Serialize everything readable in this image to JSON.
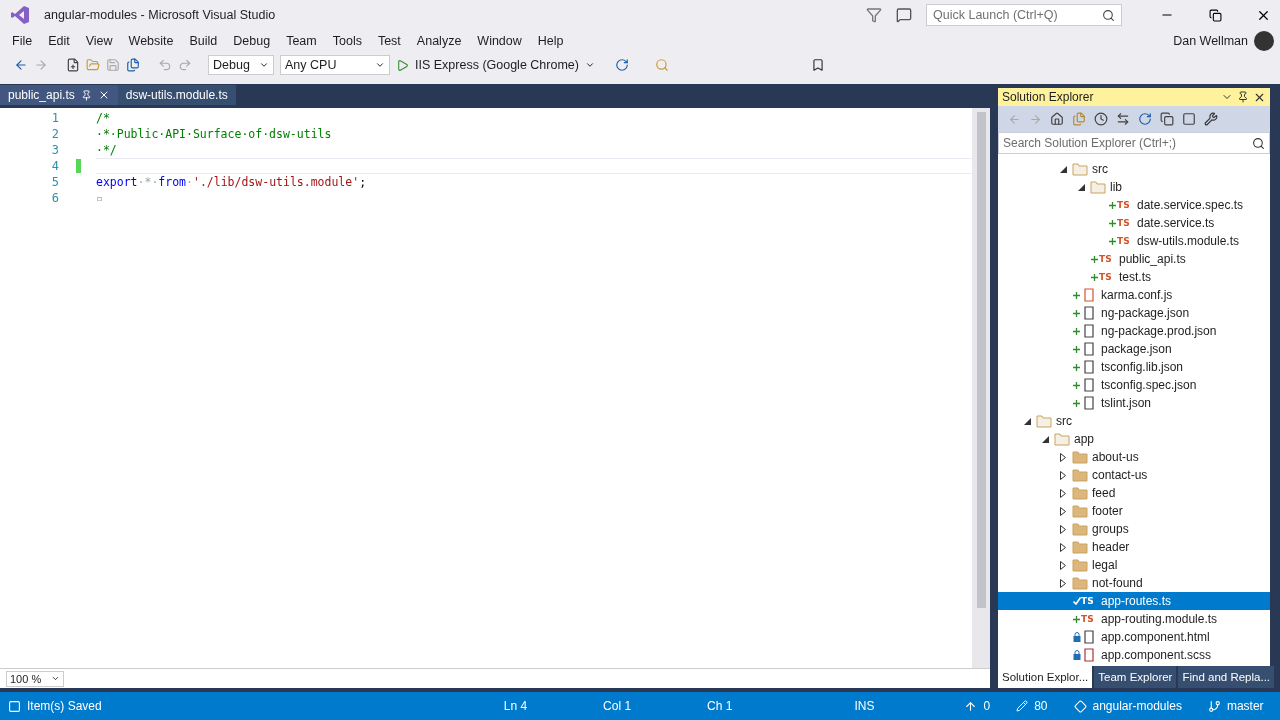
{
  "window": {
    "title": "angular-modules - Microsoft Visual Studio",
    "quick_launch": {
      "placeholder": "Quick Launch (Ctrl+Q)"
    },
    "user": "Dan Wellman"
  },
  "menu": [
    "File",
    "Edit",
    "View",
    "Website",
    "Build",
    "Debug",
    "Team",
    "Tools",
    "Test",
    "Analyze",
    "Window",
    "Help"
  ],
  "toolbar": {
    "configuration": "Debug",
    "platform": "Any CPU",
    "run_target": "IIS Express (Google Chrome)"
  },
  "editor": {
    "tabs": [
      {
        "label": "public_api.ts",
        "selected": true,
        "pinned": true
      },
      {
        "label": "dsw-utils.module.ts",
        "selected": false,
        "pinned": false
      }
    ],
    "lines": [
      {
        "number": "1",
        "current": false,
        "segments": [
          {
            "kind": "comment",
            "text": "/*"
          }
        ]
      },
      {
        "number": "2",
        "current": false,
        "segments": [
          {
            "kind": "comment",
            "text": "·*·Public·API·Surface·of·dsw-utils"
          }
        ]
      },
      {
        "number": "3",
        "current": false,
        "segments": [
          {
            "kind": "comment",
            "text": "·*/"
          }
        ]
      },
      {
        "number": "4",
        "current": true
      },
      {
        "number": "5",
        "current": false,
        "segments": [
          {
            "kind": "keyword",
            "text": "export"
          },
          {
            "kind": "space",
            "text": "·*·"
          },
          {
            "kind": "keyword",
            "text": "from"
          },
          {
            "kind": "space",
            "text": "·"
          },
          {
            "kind": "string",
            "text": "'./lib/dsw-utils.module'"
          },
          {
            "kind": "plain",
            "text": ";"
          }
        ]
      },
      {
        "number": "6",
        "current": false,
        "segments": [
          {
            "kind": "space",
            "text": "▫"
          }
        ]
      }
    ],
    "zoom": "100 %"
  },
  "solution_explorer": {
    "title": "Solution Explorer",
    "search": {
      "placeholder": "Search Solution Explorer (Ctrl+;)"
    },
    "tree": [
      {
        "children": [
          {
            "children": [
              {
                "label": "src",
                "kind": "folder",
                "expanded": true,
                "selected": false,
                "children": [
                  {
                    "label": "lib",
                    "kind": "folder",
                    "expanded": true,
                    "selected": false,
                    "children": [
                      {
                        "label": "date.service.spec.ts",
                        "kind": "ts",
                        "icon_text": "TS",
                        "selected": false,
                        "badge": {
                          "kind": "added"
                        }
                      },
                      {
                        "label": "date.service.ts",
                        "kind": "ts",
                        "icon_text": "TS",
                        "selected": false,
                        "badge": {
                          "kind": "added"
                        }
                      },
                      {
                        "label": "dsw-utils.module.ts",
                        "kind": "ts",
                        "icon_text": "TS",
                        "selected": false,
                        "badge": {
                          "kind": "added"
                        }
                      }
                    ]
                  },
                  {
                    "label": "public_api.ts",
                    "kind": "ts",
                    "icon_text": "TS",
                    "selected": false,
                    "badge": {
                      "kind": "added"
                    }
                  },
                  {
                    "label": "test.ts",
                    "kind": "ts",
                    "icon_text": "TS",
                    "selected": false,
                    "badge": {
                      "kind": "added"
                    }
                  }
                ]
              },
              {
                "label": "karma.conf.js",
                "kind": "js",
                "selected": false,
                "badge": {
                  "kind": "added"
                }
              },
              {
                "label": "ng-package.json",
                "kind": "config",
                "selected": false,
                "badge": {
                  "kind": "added"
                }
              },
              {
                "label": "ng-package.prod.json",
                "kind": "config",
                "selected": false,
                "badge": {
                  "kind": "added"
                }
              },
              {
                "label": "package.json",
                "kind": "config",
                "selected": false,
                "badge": {
                  "kind": "added"
                }
              },
              {
                "label": "tsconfig.lib.json",
                "kind": "config",
                "selected": false,
                "badge": {
                  "kind": "added"
                }
              },
              {
                "label": "tsconfig.spec.json",
                "kind": "config",
                "selected": false,
                "badge": {
                  "kind": "added"
                }
              },
              {
                "label": "tslint.json",
                "kind": "config",
                "selected": false,
                "badge": {
                  "kind": "added"
                }
              }
            ]
          }
        ]
      },
      {
        "label": "src",
        "kind": "folder",
        "expanded": true,
        "selected": false,
        "children": [
          {
            "label": "app",
            "kind": "folder",
            "expanded": true,
            "selected": false,
            "children": [
              {
                "label": "about-us",
                "kind": "folder",
                "expanded": false,
                "selected": false
              },
              {
                "label": "contact-us",
                "kind": "folder",
                "expanded": false,
                "selected": false
              },
              {
                "label": "feed",
                "kind": "folder",
                "expanded": false,
                "selected": false
              },
              {
                "label": "footer",
                "kind": "folder",
                "expanded": false,
                "selected": false
              },
              {
                "label": "groups",
                "kind": "folder",
                "expanded": false,
                "selected": false
              },
              {
                "label": "header",
                "kind": "folder",
                "expanded": false,
                "selected": false
              },
              {
                "label": "legal",
                "kind": "folder",
                "expanded": false,
                "selected": false
              },
              {
                "label": "not-found",
                "kind": "folder",
                "expanded": false,
                "selected": false
              },
              {
                "label": "app-routes.ts",
                "kind": "ts",
                "icon_text": "TS",
                "selected": true,
                "badge": {
                  "kind": "modified"
                }
              },
              {
                "label": "app-routing.module.ts",
                "kind": "ts",
                "icon_text": "TS",
                "selected": false,
                "badge": {
                  "kind": "added"
                }
              },
              {
                "label": "app.component.html",
                "kind": "html",
                "selected": false,
                "badge": {
                  "kind": "locked"
                }
              },
              {
                "label": "app.component.scss",
                "kind": "scss",
                "selected": false,
                "badge": {
                  "kind": "locked"
                }
              }
            ]
          }
        ]
      }
    ],
    "bottom_tabs": [
      {
        "label": "Solution Explor...",
        "selected": true
      },
      {
        "label": "Team Explorer",
        "selected": false
      },
      {
        "label": "Find and Repla...",
        "selected": false
      }
    ]
  },
  "status_bar": {
    "message": "Item(s) Saved",
    "line": "Ln 4",
    "column": "Col 1",
    "char": "Ch 1",
    "mode": "INS",
    "unpushed": "0",
    "changes": "80",
    "repository": "angular-modules",
    "branch": "master"
  }
}
